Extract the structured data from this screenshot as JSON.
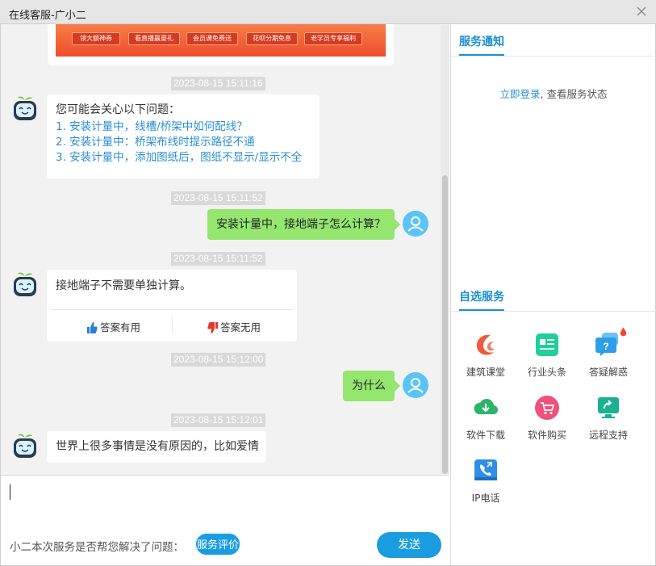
{
  "window": {
    "title": "在线客服-广小二",
    "close_icon": "close-icon"
  },
  "banner": {
    "chips": [
      "领大额神券",
      "看直播赢豪礼",
      "会员课免费送",
      "花呗分期免息",
      "老学员专享福利"
    ]
  },
  "messages": [
    {
      "type": "timestamp",
      "text": "2023-08-15 15:11:16"
    },
    {
      "type": "bot",
      "intro": "您可能会关心以下问题：",
      "questions": [
        "1. 安装计量中，线槽/桥架中如何配线？",
        "2. 安装计量中：桥架布线时提示路径不通",
        "3. 安装计量中，添加图纸后，图纸不显示/显示不全"
      ]
    },
    {
      "type": "timestamp",
      "text": "2023-08-15 15:11:52"
    },
    {
      "type": "user",
      "text": "安装计量中，接地端子怎么计算？"
    },
    {
      "type": "timestamp",
      "text": "2023-08-15 15:11:52"
    },
    {
      "type": "bot",
      "text": "接地端子不需要单独计算。",
      "useful": "答案有用",
      "useless": "答案无用"
    },
    {
      "type": "timestamp",
      "text": "2023-08-15 15:12:00"
    },
    {
      "type": "user",
      "text": "为什么"
    },
    {
      "type": "timestamp",
      "text": "2023-08-15 15:12:01"
    },
    {
      "type": "bot",
      "text": "世界上很多事情是没有原因的，比如爱情"
    }
  ],
  "input": {
    "ask": "小二本次服务是否帮您解决了问题：",
    "rate_label": "服务评价",
    "send_label": "发送"
  },
  "right": {
    "notice_title": "服务通知",
    "login_link": "立即登录",
    "login_rest": ", 查看服务状态",
    "self_title": "自选服务",
    "services": [
      {
        "label": "建筑课堂",
        "icon": "course-icon",
        "color": "#ef5a3c"
      },
      {
        "label": "行业头条",
        "icon": "news-icon",
        "color": "#1fcf9a"
      },
      {
        "label": "答疑解惑",
        "icon": "qa-icon",
        "color": "#2d9ee8"
      },
      {
        "label": "软件下载",
        "icon": "download-icon",
        "color": "#2bb56b"
      },
      {
        "label": "软件购买",
        "icon": "cart-icon",
        "color": "#f0507a"
      },
      {
        "label": "远程支持",
        "icon": "remote-icon",
        "color": "#1cb093"
      },
      {
        "label": "IP电话",
        "icon": "phone-icon",
        "color": "#2d8fe6"
      }
    ]
  }
}
